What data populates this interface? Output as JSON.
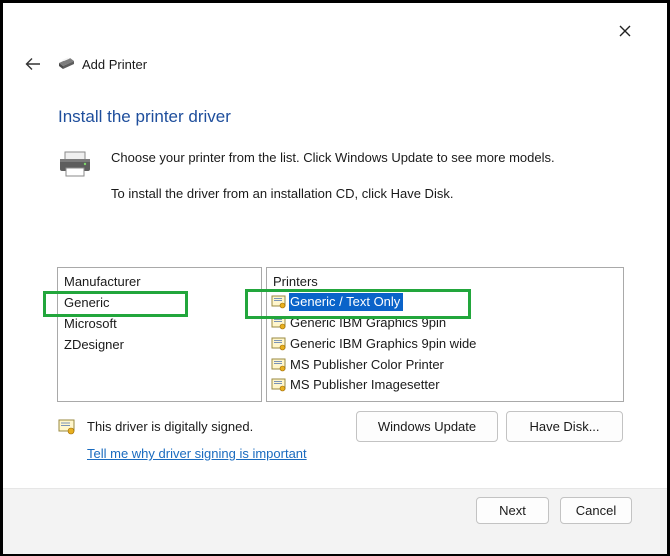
{
  "window": {
    "title": "Add Printer",
    "close_icon": "close-icon",
    "back_icon": "back-arrow-icon",
    "title_icon": "printer-icon"
  },
  "page": {
    "heading": "Install the printer driver",
    "description_line1": "Choose your printer from the list. Click Windows Update to see more models.",
    "description_line2": "To install the driver from an installation CD, click Have Disk."
  },
  "manufacturer_list": {
    "header": "Manufacturer",
    "items": [
      "Generic",
      "Microsoft",
      "ZDesigner"
    ],
    "highlighted": "Generic"
  },
  "printer_list": {
    "header": "Printers",
    "items": [
      "Generic / Text Only",
      "Generic IBM Graphics 9pin",
      "Generic IBM Graphics 9pin wide",
      "MS Publisher Color Printer",
      "MS Publisher Imagesetter"
    ],
    "selected": "Generic / Text Only"
  },
  "signature": {
    "text": "This driver is digitally signed.",
    "link": "Tell me why driver signing is important",
    "icon": "certificate-icon"
  },
  "buttons": {
    "windows_update": "Windows Update",
    "have_disk": "Have Disk...",
    "next": "Next",
    "cancel": "Cancel"
  },
  "colors": {
    "heading": "#1e4e9c",
    "selection": "#0a63c9",
    "highlight_box": "#22a63c",
    "link": "#1a6bbf"
  }
}
